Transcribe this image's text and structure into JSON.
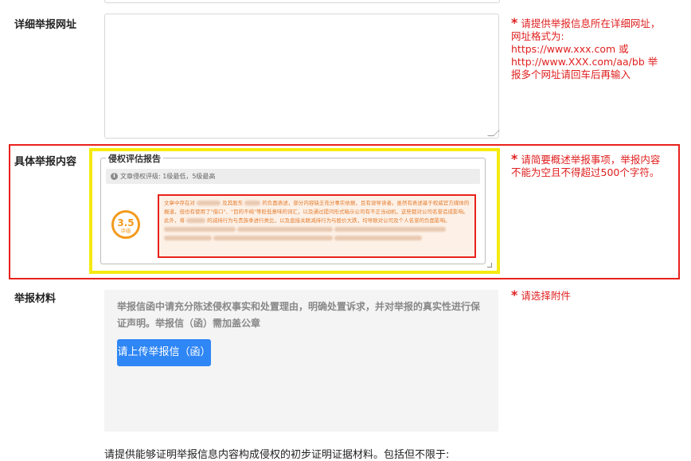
{
  "fields": {
    "url": {
      "label": "详细举报网址",
      "hint_star": "*",
      "hint_lines": [
        "请提供举报信息所在详细网址，",
        "网址格式为:",
        "https://www.xxx.com 或",
        "http://www.XXX.com/aa/bb 举",
        "报多个网址请回车后再输入"
      ],
      "value": ""
    },
    "content": {
      "label": "具体举报内容",
      "hint_star": "*",
      "hint_lines": [
        "请简要概述举报事项，举报内容",
        "不能为空且不得超过500个字符。"
      ],
      "report": {
        "legend": "侵权评估报告",
        "rating_note": "文章侵权评级: 1级最低，5级最高",
        "score": "3.5",
        "score_label": "评级",
        "analysis_segments": [
          "文章中存在对",
          "及其股东",
          "的负面表述，部分内容缺乏充分事实依据，且有误导读者。虽然有表述基于权威官方媒体的报道，但也有使用了\"借口\"、\"目的不纯\"等贬低意味的词汇，以及通过提问形式暗示公司有不正当动机，这些都对公司名誉造成影响。此外，将",
          "的减持行为与贵族季进行类比，以及直接关联减持行为与股价大跌，均导致对公司及个人名誉的负面影响。"
        ]
      }
    },
    "materials": {
      "label": "举报材料",
      "hint_star": "*",
      "hint_lines": [
        "请选择附件"
      ],
      "description": "举报信函中请充分陈述侵权事实和处置理由，明确处置诉求，并对举报的真实性进行保证声明。举报信（函）需加盖公章",
      "upload_button": "请上传举报信（函）"
    }
  },
  "footer_text": "请提供能够证明举报信息内容构成侵权的初步证明证据材料。包括但不限于:",
  "colors": {
    "hint_red": "#e02020",
    "highlight_red": "#e8221b",
    "highlight_yellow": "#f5ea10",
    "score_orange": "#f39a1c",
    "button_blue": "#2f86f5"
  }
}
